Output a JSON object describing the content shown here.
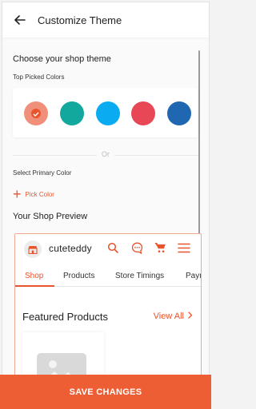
{
  "appbar": {
    "title": "Customize Theme",
    "back_icon": "arrow-left-icon"
  },
  "theme": {
    "heading": "Choose your shop theme",
    "top_picked_label": "Top Picked Colors",
    "swatches": [
      {
        "color": "#f0907a",
        "selected": true
      },
      {
        "color": "#13a89e",
        "selected": false
      },
      {
        "color": "#0aabf1",
        "selected": false
      },
      {
        "color": "#e84756",
        "selected": false
      },
      {
        "color": "#1f67b0",
        "selected": false
      }
    ],
    "or_label": "Or",
    "primary_label": "Select Primary Color",
    "pick_color_label": "Pick Color"
  },
  "preview": {
    "heading": "Your Shop Preview",
    "shop_name": "cuteteddy",
    "icons": [
      "search-icon",
      "chat-icon",
      "cart-icon",
      "menu-icon"
    ],
    "tabs": [
      "Shop",
      "Products",
      "Store Timings",
      "Payn"
    ],
    "active_tab": "Shop",
    "featured_label": "Featured Products",
    "view_all_label": "View All",
    "accent": "#e9542d"
  },
  "footer": {
    "save_label": "SAVE CHANGES",
    "color": "#ee5e35"
  }
}
